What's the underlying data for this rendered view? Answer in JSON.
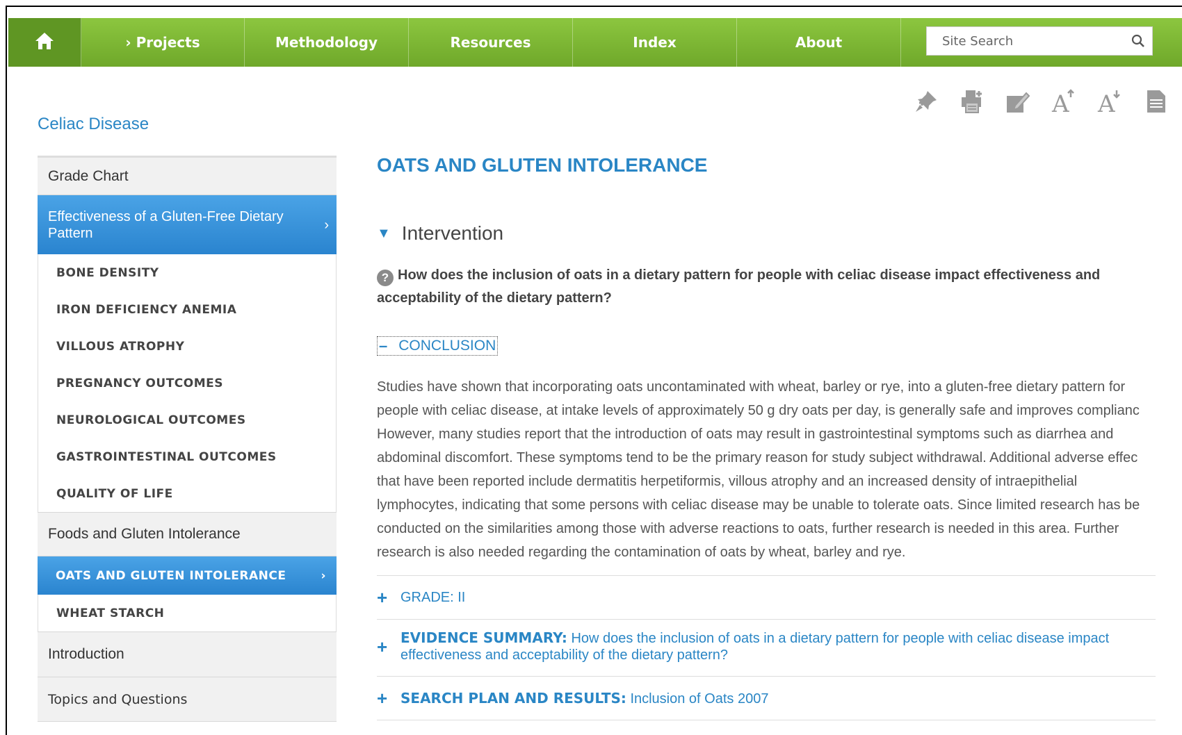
{
  "nav": {
    "items": [
      "› Projects",
      "Methodology",
      "Resources",
      "Index",
      "About"
    ],
    "search_placeholder": "Site Search"
  },
  "tools": [
    "pin-icon",
    "print-icon",
    "edit-icon",
    "font-increase-icon",
    "font-decrease-icon",
    "document-icon"
  ],
  "sidebar": {
    "title": "Celiac Disease",
    "grade_chart": "Grade Chart",
    "effectiveness": "Effectiveness of a Gluten-Free Dietary Pattern",
    "effectiveness_subs": [
      "BONE DENSITY",
      "IRON DEFICIENCY ANEMIA",
      "VILLOUS ATROPHY",
      "PREGNANCY OUTCOMES",
      "NEUROLOGICAL OUTCOMES",
      "GASTROINTESTINAL OUTCOMES",
      "QUALITY OF LIFE"
    ],
    "foods": "Foods and Gluten Intolerance",
    "oats_active": "OATS AND GLUTEN INTOLERANCE",
    "wheat_starch": "WHEAT STARCH",
    "introduction": "Introduction",
    "topics": "Topics and Questions",
    "chevron": "›"
  },
  "main": {
    "title": "OATS AND GLUTEN INTOLERANCE",
    "intervention": "Intervention",
    "question": "How does the inclusion of oats in a dietary pattern for people with celiac disease impact effectiveness and acceptability of the dietary pattern?",
    "conclusion_label": "CONCLUSION",
    "conclusion_sign": "–",
    "conclusion_lines": [
      "Studies have shown that incorporating oats uncontaminated with wheat, barley or rye, into a gluten-free dietary pattern for",
      "people with celiac disease, at intake levels of approximately 50 g dry oats per day, is generally safe and improves complianc",
      "However, many studies report that the introduction of oats may result in gastrointestinal symptoms such as diarrhea and",
      "abdominal discomfort. These symptoms tend to be the primary reason for study subject withdrawal. Additional adverse effec",
      "that have been reported include dermatitis herpetiformis, villous atrophy and an increased density of intraepithelial",
      "lymphocytes, indicating that some persons with celiac disease may be unable to tolerate oats. Since limited research has be",
      "conducted on the similarities among those with adverse reactions to oats, further research is needed in this area. Further",
      "research is also needed regarding the contamination of oats by wheat, barley and rye."
    ],
    "grade_label": "GRADE: II",
    "evidence_label": "EVIDENCE SUMMARY:",
    "evidence_text": "How does the inclusion of oats in a dietary pattern for people with celiac disease impact effectiveness and acceptability of the dietary pattern?",
    "search_label": "SEARCH PLAN AND RESULTS:",
    "search_text": "Inclusion of Oats 2007",
    "plus": "+"
  }
}
